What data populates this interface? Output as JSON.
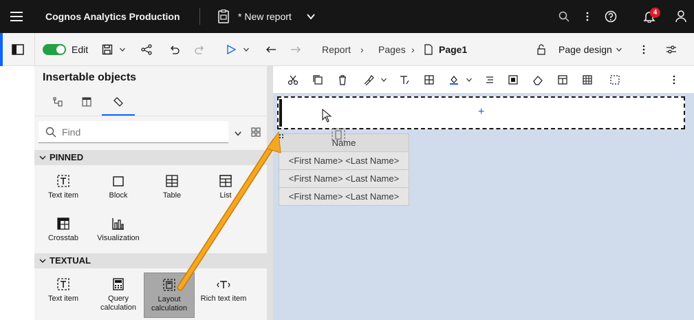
{
  "topbar": {
    "app_name": "Cognos Analytics Production",
    "report_title": "* New report",
    "notification_count": "4"
  },
  "toolbar": {
    "edit_label": "Edit",
    "breadcrumb": [
      "Report",
      "Pages",
      "Page1"
    ],
    "page_design": "Page design"
  },
  "panel": {
    "title": "Insertable objects",
    "search_placeholder": "Find",
    "sections": [
      {
        "name": "PINNED",
        "items": [
          "Text item",
          "Block",
          "Table",
          "List",
          "Crosstab",
          "Visualization"
        ]
      },
      {
        "name": "TEXTUAL",
        "items": [
          "Text item",
          "Query\ncalculation",
          "Layout\ncalculation",
          "Rich text item"
        ]
      }
    ]
  },
  "list": {
    "header": "Name",
    "rows": [
      "<First Name> <Last Name>",
      "<First Name> <Last Name>",
      "<First Name> <Last Name>"
    ]
  },
  "colors": {
    "accent": "#0f62fe",
    "toggle_on": "#24a148",
    "badge": "#da1e28",
    "arrow": "#f5a623",
    "canvas_bg": "#d0dcec"
  }
}
